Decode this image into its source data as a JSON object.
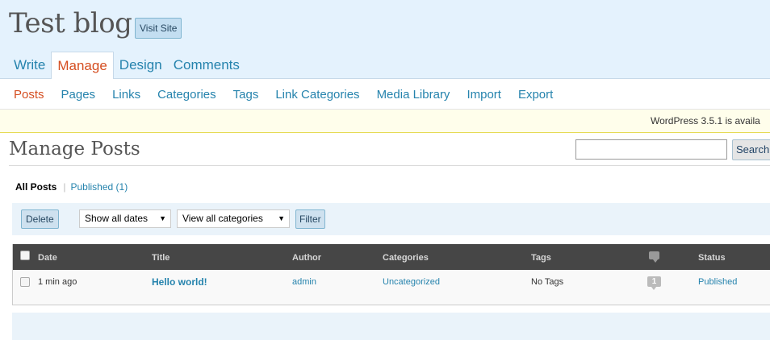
{
  "header": {
    "blog_title": "Test blog",
    "visit_site": "Visit Site",
    "tabs": [
      "Write",
      "Manage",
      "Design",
      "Comments"
    ],
    "active_tab": "Manage"
  },
  "subnav": {
    "items": [
      "Posts",
      "Pages",
      "Links",
      "Categories",
      "Tags",
      "Link Categories",
      "Media Library",
      "Import",
      "Export"
    ],
    "active": "Posts"
  },
  "update_nag": "WordPress 3.5.1 is availa",
  "page": {
    "heading": "Manage Posts",
    "search_button": "Search",
    "search_value": ""
  },
  "filters": {
    "all": "All Posts",
    "published": "Published (1)"
  },
  "tablenav": {
    "delete": "Delete",
    "date_select": "Show all dates",
    "category_select": "View all categories",
    "filter": "Filter"
  },
  "table": {
    "columns": {
      "date": "Date",
      "title": "Title",
      "author": "Author",
      "categories": "Categories",
      "tags": "Tags",
      "status": "Status"
    },
    "rows": [
      {
        "date": "1 min ago",
        "title": "Hello world!",
        "author": "admin",
        "categories": "Uncategorized",
        "tags": "No Tags",
        "comments": "1",
        "status": "Published"
      }
    ]
  },
  "icons": {
    "comment_header": "comment-bubble-icon",
    "comment_count": "comment-count-icon",
    "dropdown_arrow": "dropdown-arrow-icon"
  },
  "colors": {
    "link": "#2583ad",
    "active": "#d54e21",
    "header_bg": "#e4f2fd",
    "table_head": "#464646",
    "nag_bg": "#fffeeb"
  }
}
